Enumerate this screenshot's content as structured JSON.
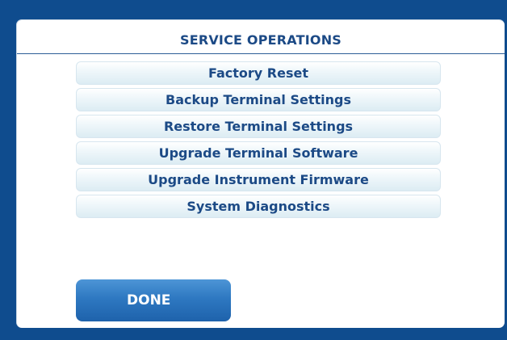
{
  "title": "SERVICE OPERATIONS",
  "menu": {
    "items": [
      {
        "label": "Factory Reset"
      },
      {
        "label": "Backup Terminal Settings"
      },
      {
        "label": "Restore Terminal Settings"
      },
      {
        "label": "Upgrade Terminal Software"
      },
      {
        "label": "Upgrade Instrument Firmware"
      },
      {
        "label": "System Diagnostics"
      }
    ]
  },
  "footer": {
    "done_label": "DONE"
  },
  "colors": {
    "background": "#0f4c8e",
    "panel": "#ffffff",
    "title_text": "#1c4a86",
    "button_blue": "#2e78c1"
  }
}
